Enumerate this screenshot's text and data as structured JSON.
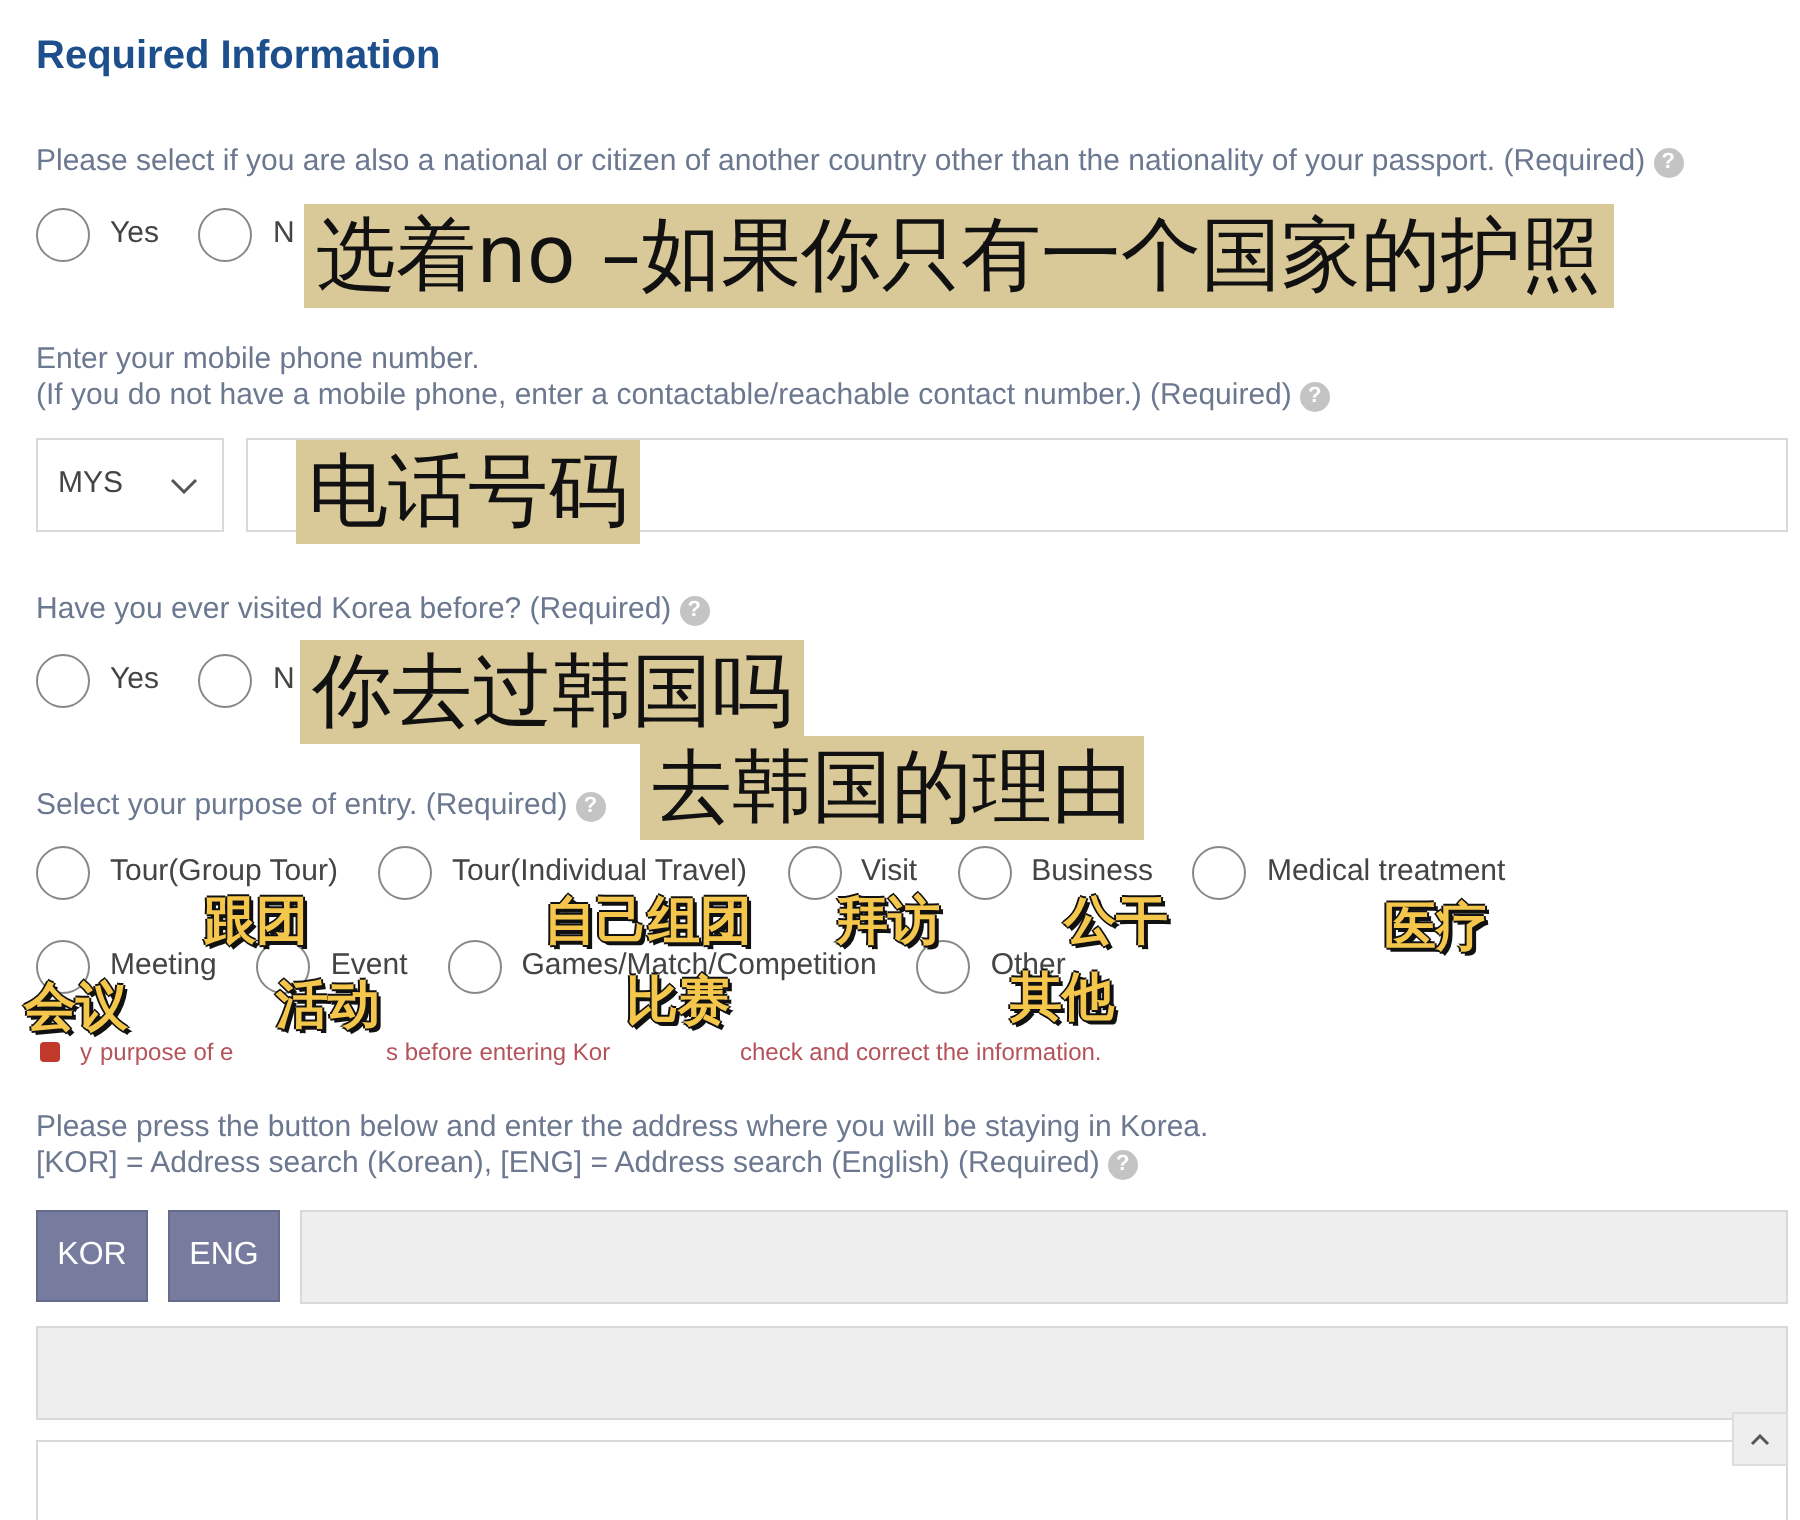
{
  "title": "Required Information",
  "dual_nationality": {
    "label": "Please select if you are also a national or citizen of another country other than the nationality of your passport. (Required)",
    "help_icon": "?",
    "options": [
      {
        "label": "Yes",
        "selected": false
      },
      {
        "label": "N",
        "selected": false
      }
    ]
  },
  "mobile": {
    "label_lines": [
      "Enter your mobile phone number.",
      "(If you do not have a mobile phone, enter a contactable/reachable contact number.) (Required)"
    ],
    "help_icon": "?",
    "country_code": "MYS"
  },
  "visited_korea": {
    "label": "Have you ever visited Korea before? (Required)",
    "help_icon": "?",
    "options": [
      {
        "label": "Yes",
        "selected": false
      },
      {
        "label": "N",
        "selected": false
      }
    ]
  },
  "purpose": {
    "label": "Select your purpose of entry. (Required)",
    "help_icon": "?",
    "option_rows": [
      [
        {
          "label": "Tour(Group Tour)",
          "selected": false
        },
        {
          "label": "Tour(Individual Travel)",
          "selected": false
        },
        {
          "label": "Visit",
          "selected": false
        },
        {
          "label": "Business",
          "selected": false
        },
        {
          "label": "Medical treatment",
          "selected": false
        }
      ],
      [
        {
          "label": "Meeting",
          "selected": false
        },
        {
          "label": "Event",
          "selected": false
        },
        {
          "label": "Games/Match/Competition",
          "selected": false
        },
        {
          "label": "Other",
          "selected": false
        }
      ]
    ],
    "error_fragments": [
      "y",
      "purpose of e",
      "s before entering Kor",
      "check and correct the information."
    ]
  },
  "address": {
    "label_lines": [
      "Please press the button below and enter the address where you will be staying in Korea.",
      "[KOR] = Address search (Korean), [ENG] = Address search (English) (Required)"
    ],
    "help_icon": "?",
    "buttons": [
      "KOR",
      "ENG"
    ],
    "fields": [
      {
        "disabled": true
      },
      {
        "disabled": true
      },
      {
        "disabled": false
      }
    ]
  },
  "annotations": [
    {
      "kind": "banner",
      "text": "选着no –如果你只有一个国家的护照"
    },
    {
      "kind": "banner",
      "text": "电话号码"
    },
    {
      "kind": "banner",
      "text": "你去过韩国吗"
    },
    {
      "kind": "banner",
      "text": "去韩国的理由"
    },
    {
      "kind": "sticker",
      "text": "跟团"
    },
    {
      "kind": "sticker",
      "text": "自己组团"
    },
    {
      "kind": "sticker",
      "text": "拜访"
    },
    {
      "kind": "sticker",
      "text": "公干"
    },
    {
      "kind": "sticker",
      "text": "医疗"
    },
    {
      "kind": "sticker",
      "text": "会议"
    },
    {
      "kind": "sticker",
      "text": "活动"
    },
    {
      "kind": "sticker",
      "text": "比赛"
    },
    {
      "kind": "sticker",
      "text": "其他"
    }
  ]
}
